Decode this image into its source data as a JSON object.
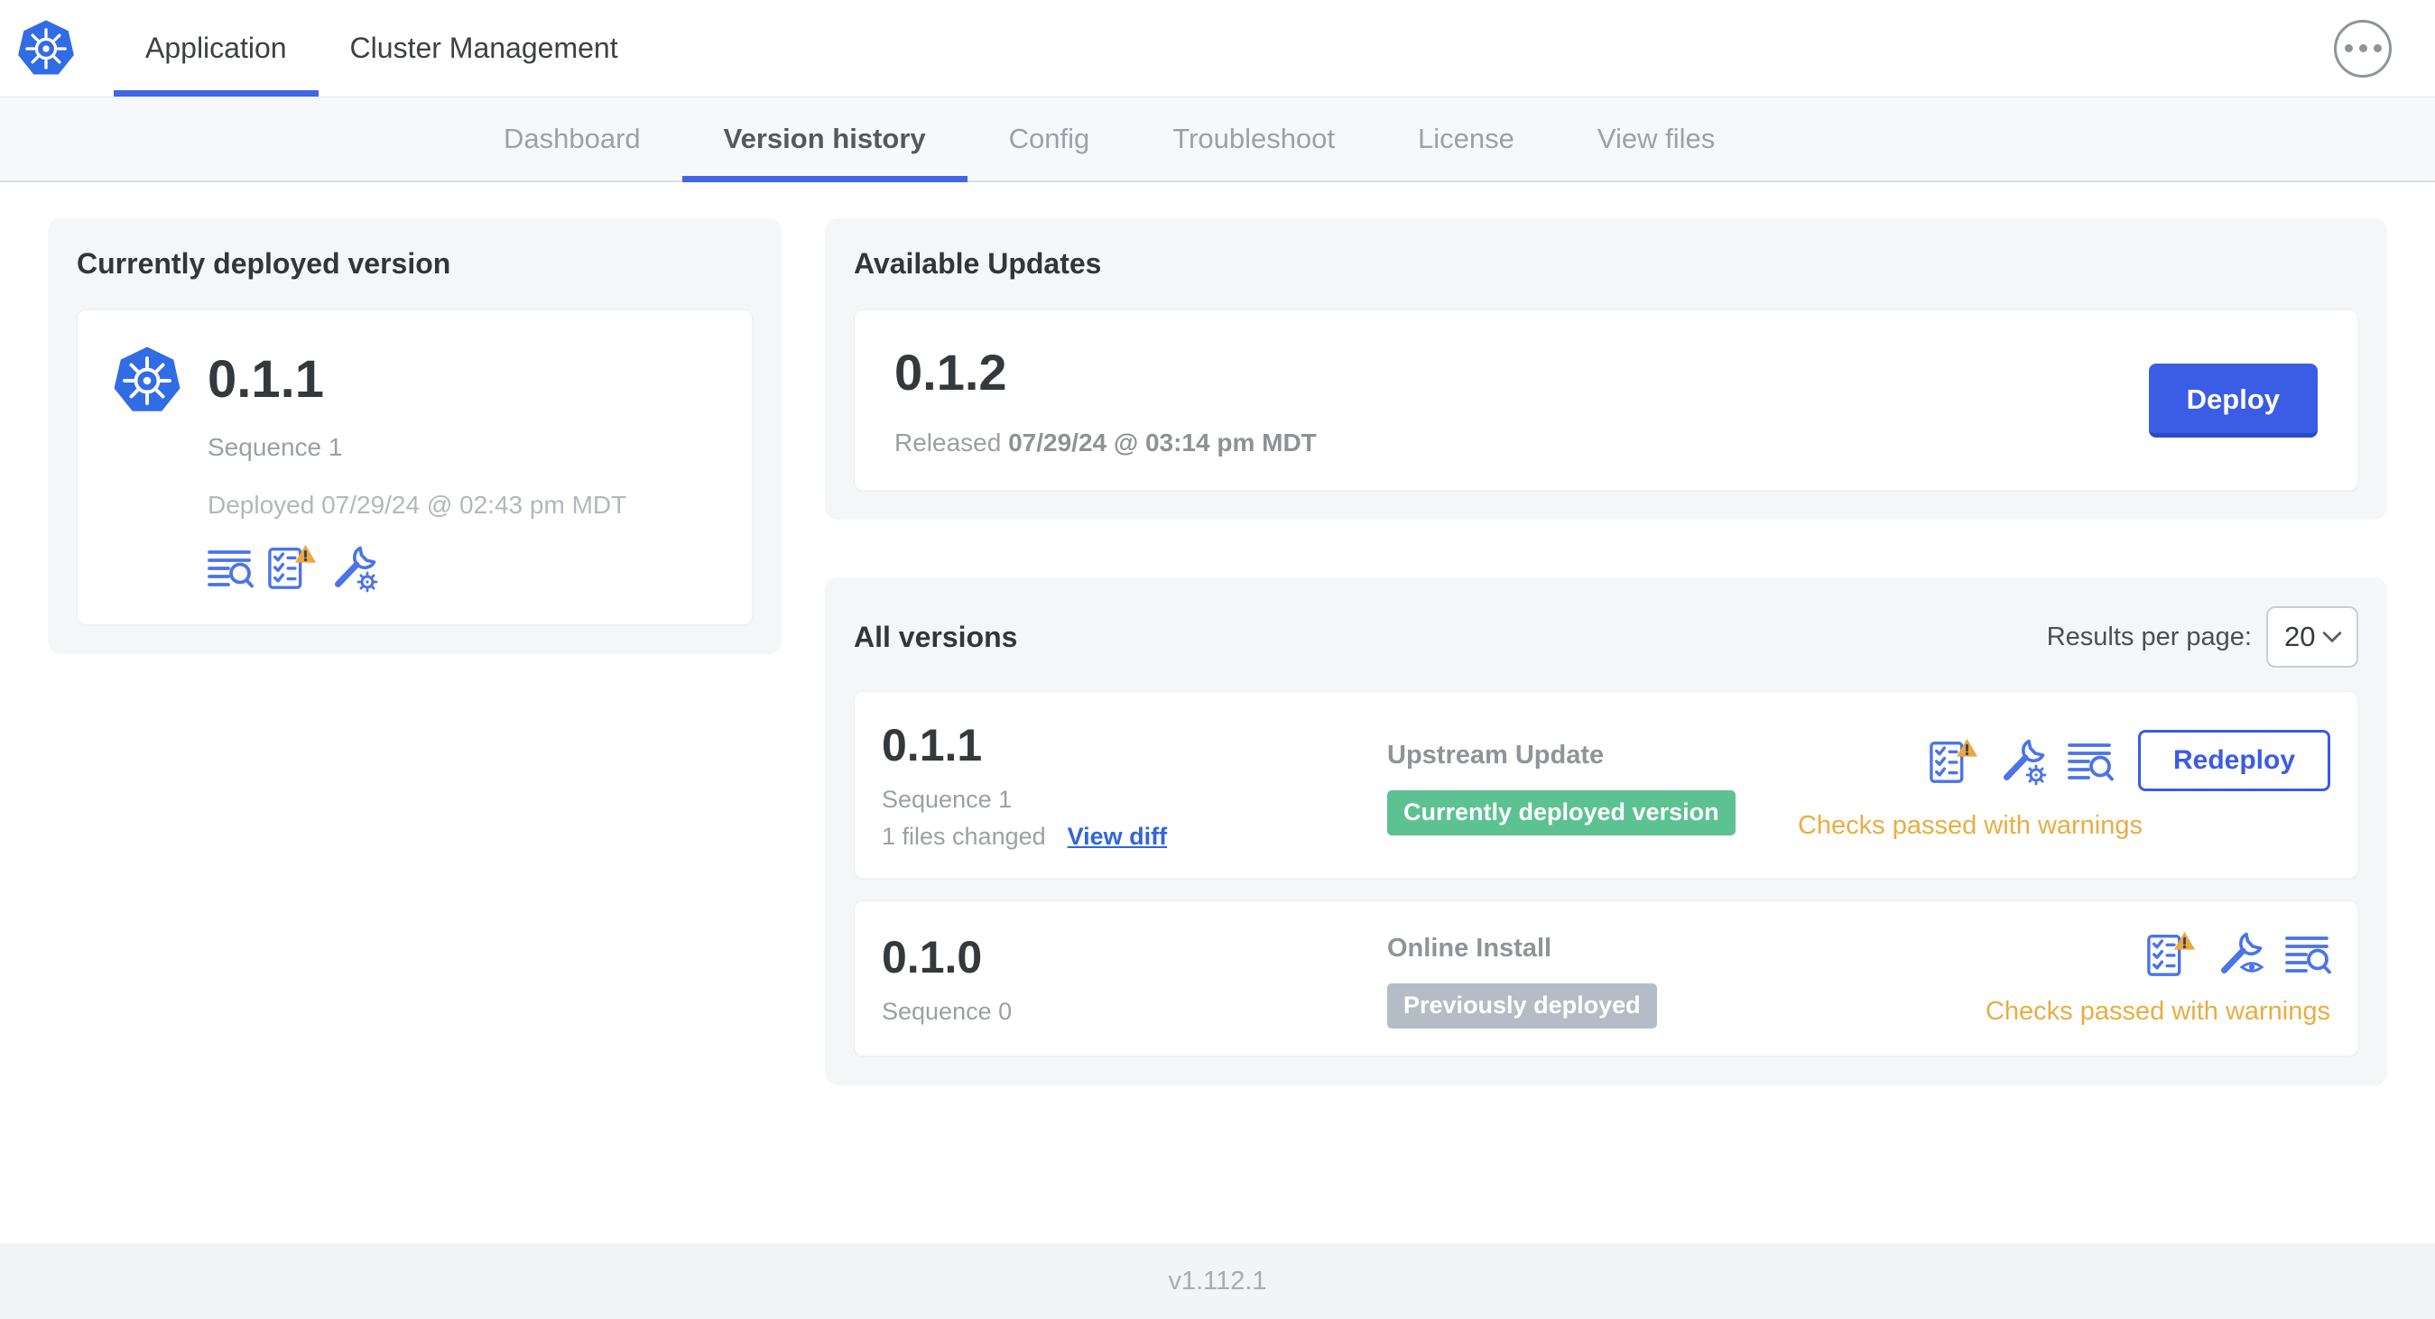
{
  "header": {
    "tabs": [
      {
        "label": "Application",
        "active": true
      },
      {
        "label": "Cluster Management",
        "active": false
      }
    ],
    "menu_icon": "ellipsis-icon"
  },
  "subnav": {
    "tabs": [
      {
        "label": "Dashboard",
        "active": false
      },
      {
        "label": "Version history",
        "active": true
      },
      {
        "label": "Config",
        "active": false
      },
      {
        "label": "Troubleshoot",
        "active": false
      },
      {
        "label": "License",
        "active": false
      },
      {
        "label": "View files",
        "active": false
      }
    ]
  },
  "current_version_card": {
    "title": "Currently deployed version",
    "version": "0.1.1",
    "sequence": "Sequence 1",
    "deployed": "Deployed 07/29/24 @ 02:43 pm MDT",
    "icons": [
      "logs-icon",
      "preflight-checks-warning-icon",
      "edit-config-icon"
    ]
  },
  "available_updates": {
    "title": "Available Updates",
    "version": "0.1.2",
    "released_prefix": "Released",
    "released_date": "07/29/24 @ 03:14 pm MDT",
    "deploy_label": "Deploy"
  },
  "all_versions": {
    "title": "All versions",
    "results_per_page_label": "Results per page:",
    "results_per_page_value": "20",
    "rows": [
      {
        "version": "0.1.1",
        "sequence": "Sequence 1",
        "files_changed": "1 files changed",
        "view_diff_label": "View diff",
        "source": "Upstream Update",
        "status_label": "Currently deployed version",
        "status_type": "deployed",
        "action_label": "Redeploy",
        "checks_text": "Checks passed with warnings",
        "icons": [
          "preflight-checks-warning-icon",
          "edit-config-icon",
          "logs-icon"
        ]
      },
      {
        "version": "0.1.0",
        "sequence": "Sequence 0",
        "source": "Online Install",
        "status_label": "Previously deployed",
        "status_type": "previous",
        "checks_text": "Checks passed with warnings",
        "icons": [
          "preflight-checks-warning-icon",
          "view-config-icon",
          "logs-icon"
        ]
      }
    ]
  },
  "footer": {
    "app_version": "v1.112.1"
  },
  "colors": {
    "primary": "#3b5ce4",
    "primary-dark": "#2c49c8",
    "icon-blue": "#4a74e8",
    "link": "#3065dd",
    "success": "#5cc292",
    "muted-badge": "#b4bdc5",
    "warning": "#e9ad42",
    "tri": "#eca73f",
    "container": "#f5f6f8"
  }
}
